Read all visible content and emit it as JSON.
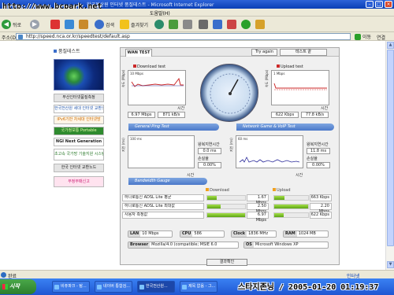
{
  "window": {
    "title": "한국전산원 인터넷 품질테스트 - Microsoft Internet Explorer",
    "watermark": "http://www.bcpark.net"
  },
  "menubar": {
    "help_label": "도움말(H)"
  },
  "toolbar": {
    "back_label": "뒤로",
    "search_label": "검색",
    "favorites_label": "즐겨찾기"
  },
  "address": {
    "label": "주소(D)",
    "url": "http://speed.nca.or.kr/speedtest/default.asp",
    "go_label": "이동",
    "links_label": "연결"
  },
  "sidebar": {
    "heading": "품질테스트",
    "banner_icon": "globe-banner-icon",
    "items": [
      {
        "label": "부산인터넷품질측정"
      },
      {
        "label": "한국전산원 세대 인터넷 교환노드"
      },
      {
        "label": "IPv6기반 차세대 인터넷망"
      },
      {
        "label": "국가정보통 Portable"
      },
      {
        "label": "NGI Next Generation"
      },
      {
        "label": "초고속 국가망 기술지원 시스템"
      },
      {
        "label": "한국 인터넷 교환노드"
      },
      {
        "label": "부정부패신고"
      }
    ]
  },
  "panel": {
    "tab_label": "WAN TEST",
    "try_again_label": "Try again",
    "status_label": "테스트 끝",
    "download": {
      "title": "Download test",
      "scale": "10 Mbps",
      "axis_label": "속도 (Mbps)",
      "time_label": "시간",
      "avg": "6.97 Mbps",
      "peak": "871 kB/s"
    },
    "upload": {
      "title": "Upload test",
      "scale": "1 Mbps",
      "axis_label": "속도 (Mbps)",
      "time_label": "시간",
      "avg": "622 Kbps",
      "peak": "77.8 kB/s"
    },
    "ping": {
      "section_label": "General Ping Test",
      "scale": "100 ms",
      "axis_label": "지연 (ms)",
      "time_label": "시간",
      "rtt_label": "왕복지연시간",
      "rtt_value": "0.0 ms",
      "loss_label": "손실율",
      "loss_value": "0.00%"
    },
    "game": {
      "section_label": "Network Game & VoIP Test",
      "scale": "60 ms",
      "axis_label": "지연 (ms)",
      "time_label": "시간",
      "rtt_label": "왕복지연시간",
      "rtt_value": "11.8 ms",
      "loss_label": "손실율",
      "loss_value": "0.00%"
    },
    "bandwidth": {
      "section_label": "Bandwidth Gauge",
      "download_legend": "Download",
      "upload_legend": "Upload",
      "rows": [
        {
          "name": "하나로통신 ADSL Lite 평균",
          "download": "1.67 Mbps",
          "download_frac": 0.24,
          "upload": "663 Kbps",
          "upload_frac": 0.3
        },
        {
          "name": "하나로통신 ADSL Lite 최대값",
          "download": "2.50 Mbps",
          "download_frac": 0.36,
          "upload": "2.20 Mbps",
          "upload_frac": 1.0
        },
        {
          "name": "사용자 측정값",
          "download": "6.97 Mbps",
          "download_frac": 1.0,
          "upload": "622 Kbps",
          "upload_frac": 0.28
        }
      ]
    },
    "system": {
      "lan_key": "LAN",
      "lan_value": "10 Mbps",
      "cpu_key": "CPU",
      "cpu_value": "586",
      "clock_key": "Clock",
      "clock_value": "1836 MHz",
      "ram_key": "RAM",
      "ram_value": "1024 MB",
      "browser_key": "Browser",
      "browser_value": "Mozilla/4.0 (compatible; MSIE 6.0",
      "os_key": "OS",
      "os_value": "Microsoft Windows XP"
    },
    "confirm_label": "결과확인"
  },
  "statusbar": {
    "text": "완료",
    "zone": "인터넷"
  },
  "taskbar": {
    "start_label": "시작",
    "items": [
      {
        "label": "비쥬파크 - 탐..."
      },
      {
        "label": "네이버 통합검..."
      },
      {
        "label": "한국전산원..."
      },
      {
        "label": "제목 없음 - 그..."
      }
    ],
    "watermark": "스타지존닝 / 2005-01-20 01:19:37"
  },
  "colors": {
    "titlebar": "#0a3fb5",
    "panel_section": "#4a78c9",
    "bar_green": "#5ca414",
    "download_line": "#cc2a2a"
  }
}
